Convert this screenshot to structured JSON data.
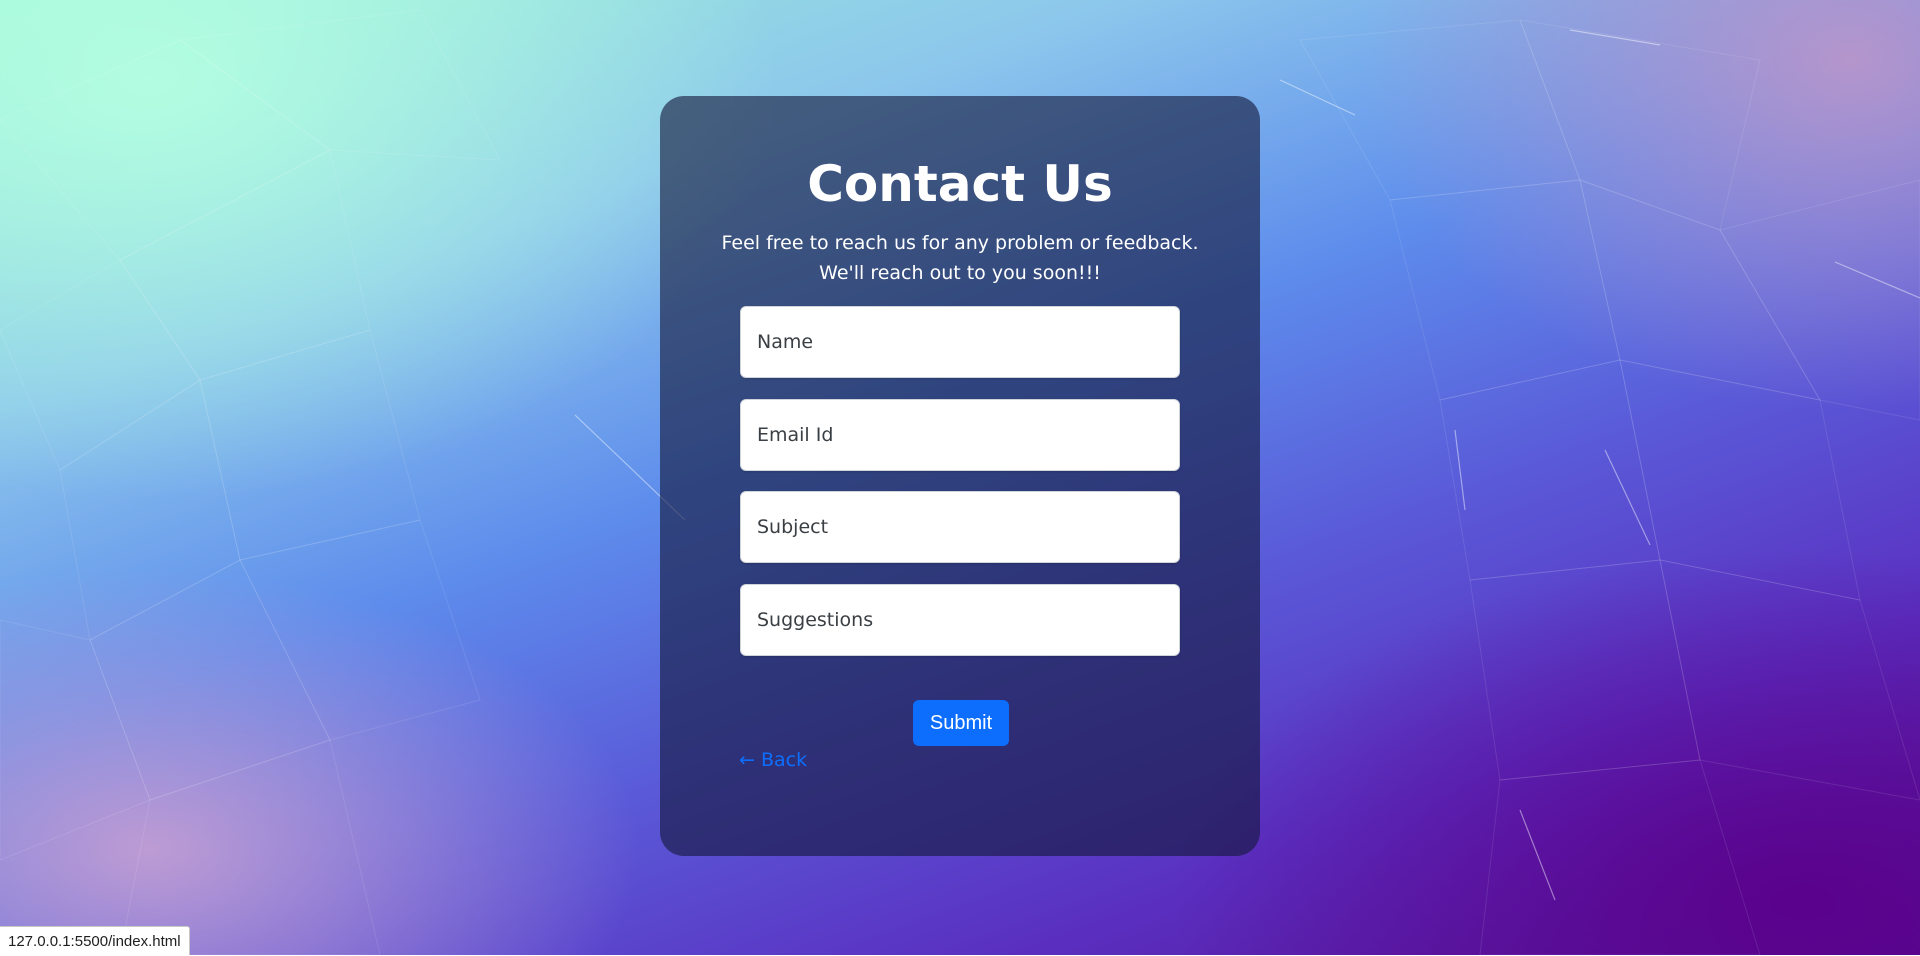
{
  "page": {
    "title": "Contact Us",
    "subtitle_line1": "Feel free to reach us for any problem or feedback.",
    "subtitle_line2": "We'll reach out to you soon!!!"
  },
  "form": {
    "name_placeholder": "Name",
    "email_placeholder": "Email Id",
    "subject_placeholder": "Subject",
    "suggestions_placeholder": "Suggestions",
    "submit_label": "Submit",
    "back_label": "← Back"
  },
  "status_bar": {
    "url": "127.0.0.1:5500/index.html"
  },
  "colors": {
    "accent": "#0d6efd",
    "card_overlay": "#14193c"
  }
}
